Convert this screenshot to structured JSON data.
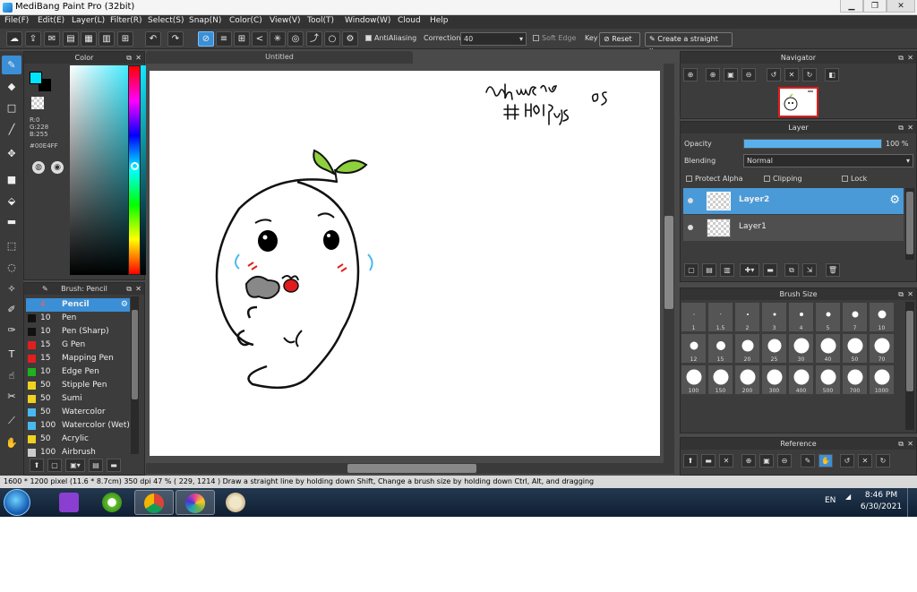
{
  "window": {
    "title": "MediBang Paint Pro (32bit)",
    "minimize": "▁",
    "maximize": "❐",
    "close": "✕"
  },
  "menu": [
    "File(F)",
    "Edit(E)",
    "Layer(L)",
    "Filter(R)",
    "Select(S)",
    "Snap(N)",
    "Color(C)",
    "View(V)",
    "Tool(T)",
    "Window(W)",
    "Cloud",
    "Help"
  ],
  "toolbar": {
    "antialiasing": "AntiAliasing",
    "correction_label": "Correction",
    "correction_value": "40",
    "soft_edge": "Soft Edge",
    "key_label": "Key",
    "reset": "Reset",
    "straight_line": "Create a straight line"
  },
  "document": {
    "tab_title": "Untitled"
  },
  "color_panel": {
    "title": "Color",
    "main_color": "#00E4FF",
    "r": "R:0",
    "g": "G:228",
    "b": "B:255",
    "hex": "#00E4FF"
  },
  "brush_panel": {
    "title": "Brush: Pencil",
    "items": [
      {
        "size": "4",
        "name": "Pencil",
        "color": "#3b8fd6"
      },
      {
        "size": "10",
        "name": "Pen",
        "color": "#111111"
      },
      {
        "size": "10",
        "name": "Pen (Sharp)",
        "color": "#111111"
      },
      {
        "size": "15",
        "name": "G Pen",
        "color": "#e02020"
      },
      {
        "size": "15",
        "name": "Mapping Pen",
        "color": "#e02020"
      },
      {
        "size": "10",
        "name": "Edge Pen",
        "color": "#20b020"
      },
      {
        "size": "50",
        "name": "Stipple Pen",
        "color": "#f0d020"
      },
      {
        "size": "50",
        "name": "Sumi",
        "color": "#f0d020"
      },
      {
        "size": "50",
        "name": "Watercolor",
        "color": "#4ab8f0"
      },
      {
        "size": "100",
        "name": "Watercolor (Wet)",
        "color": "#4ab8f0"
      },
      {
        "size": "50",
        "name": "Acrylic",
        "color": "#f0d020"
      },
      {
        "size": "100",
        "name": "Airbrush",
        "color": "#cccccc"
      }
    ]
  },
  "navigator": {
    "title": "Navigator"
  },
  "layer_panel": {
    "title": "Layer",
    "opacity_label": "Opacity",
    "opacity_value": "100 %",
    "opacity_level": 1.0,
    "blending_label": "Blending",
    "blending_value": "Normal",
    "protect_alpha": "Protect Alpha",
    "clipping": "Clipping",
    "lock": "Lock",
    "layers": [
      {
        "name": "Layer2",
        "selected": true
      },
      {
        "name": "Layer1",
        "selected": false
      }
    ]
  },
  "brush_size": {
    "title": "Brush Size",
    "sizes": [
      "1",
      "1.5",
      "2",
      "3",
      "4",
      "5",
      "7",
      "10",
      "12",
      "15",
      "20",
      "25",
      "30",
      "40",
      "50",
      "70",
      "100",
      "150",
      "200",
      "300",
      "400",
      "500",
      "700",
      "1000"
    ]
  },
  "reference": {
    "title": "Reference"
  },
  "status": {
    "text": "1600 * 1200 pixel   (11.6 * 8.7cm)   350 dpi   47 %   ( 229, 1214 )   Draw a straight line by holding down Shift, Change a brush size by holding down Ctrl, Alt, and dragging"
  },
  "taskbar": {
    "lang": "EN",
    "time": "8:46 PM",
    "date": "6/30/2021"
  }
}
